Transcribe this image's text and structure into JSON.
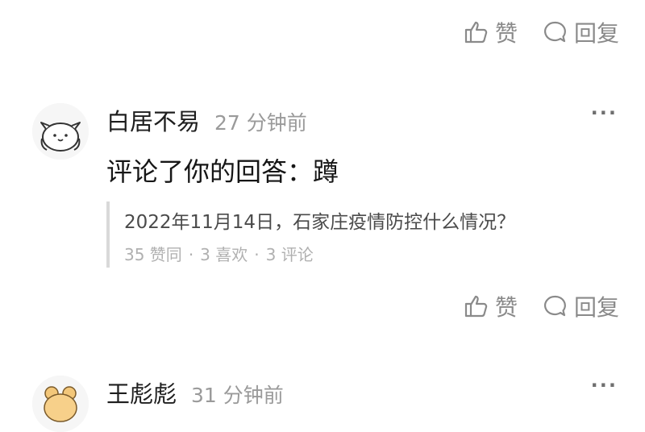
{
  "actions": {
    "like_label": "赞",
    "reply_label": "回复"
  },
  "notifications": [
    {
      "user": "白居不易",
      "time": "27 分钟前",
      "comment": "评论了你的回答：蹲",
      "quote": {
        "title": "2022年11月14日，石家庄疫情防控什么情况？",
        "stats": {
          "agree": "35 赞同",
          "likes": "3 喜欢",
          "comments": "3 评论"
        },
        "separator": "·"
      }
    },
    {
      "user": "王彪彪",
      "time": "31 分钟前"
    }
  ],
  "icons": {
    "like": "thumbs-up-icon",
    "reply": "speech-bubble-icon",
    "more": "more-icon"
  },
  "colors": {
    "text": "#1a1a1a",
    "muted": "#9a9a9a",
    "quote_border": "#d9d9d9"
  }
}
